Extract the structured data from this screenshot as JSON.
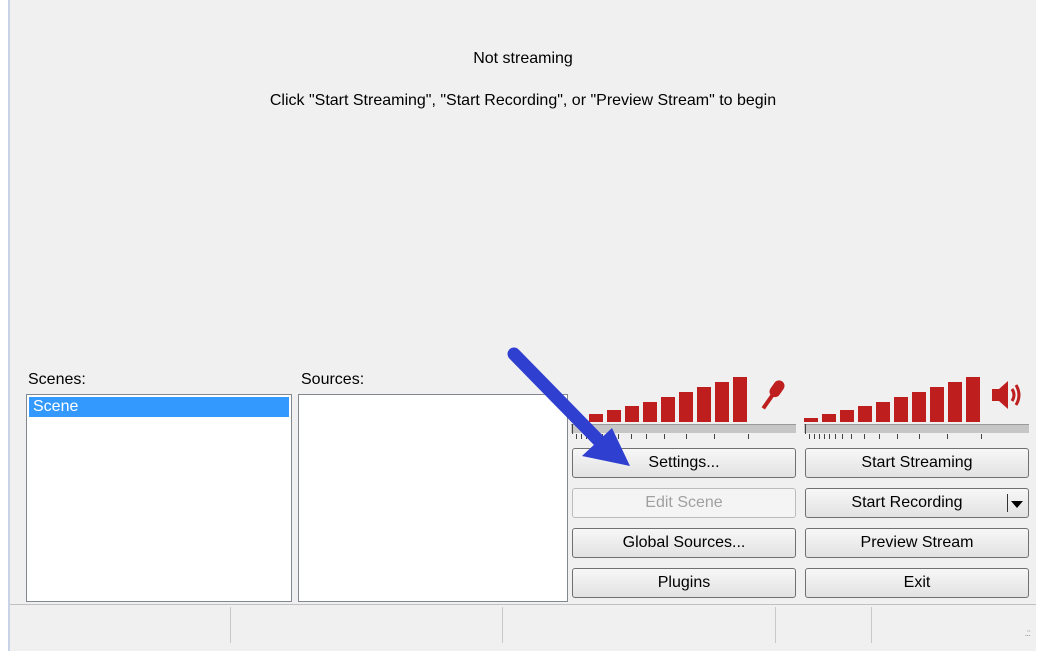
{
  "preview": {
    "status": "Not streaming",
    "hint": "Click \"Start Streaming\", \"Start Recording\", or \"Preview Stream\" to begin"
  },
  "scenes": {
    "label": "Scenes:",
    "items": [
      "Scene"
    ]
  },
  "sources": {
    "label": "Sources:",
    "items": []
  },
  "buttons": {
    "settings": "Settings...",
    "edit_scene": "Edit Scene",
    "global_sources": "Global Sources...",
    "plugins": "Plugins",
    "start_streaming": "Start Streaming",
    "start_recording": "Start Recording",
    "preview_stream": "Preview Stream",
    "exit": "Exit"
  },
  "audio": {
    "mic_icon": "microphone-icon",
    "speaker_icon": "speaker-icon",
    "meter_color": "#be1e1e"
  },
  "annotation": {
    "arrow_color": "#2f3fd0",
    "arrow_icon": "pointer-arrow"
  },
  "statusbar": {
    "cells": [
      "",
      "",
      "",
      "",
      ""
    ]
  }
}
